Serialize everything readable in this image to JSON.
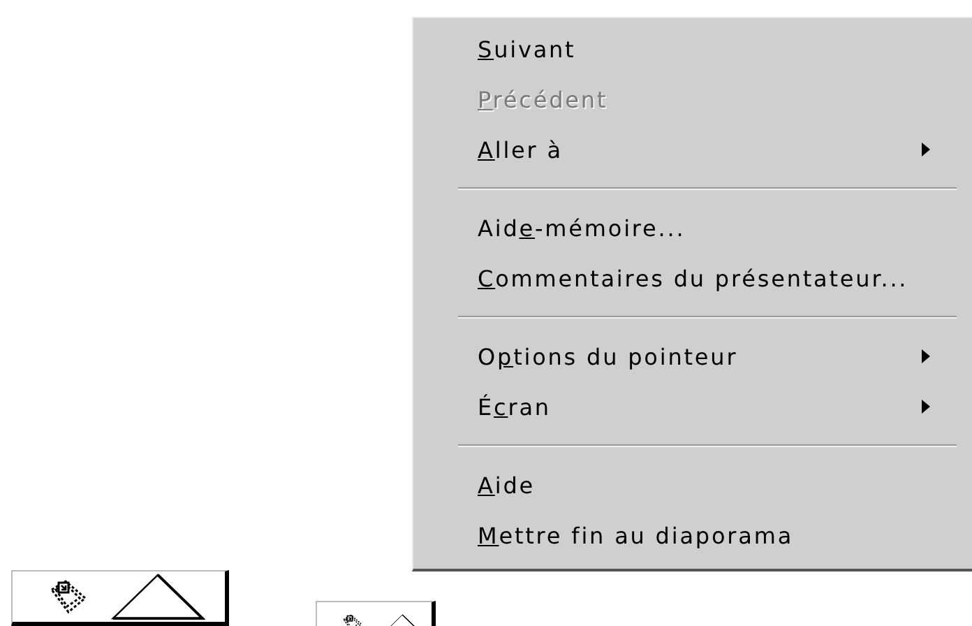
{
  "menu": {
    "items": [
      {
        "kind": "item",
        "access_key": "S",
        "label_after": "uivant",
        "disabled": false,
        "submenu": false
      },
      {
        "kind": "item",
        "access_key": "P",
        "label_after": "récédent",
        "disabled": true,
        "submenu": false
      },
      {
        "kind": "item",
        "access_key": "A",
        "label_after": "ller à",
        "disabled": false,
        "submenu": true
      },
      {
        "kind": "separator"
      },
      {
        "kind": "item",
        "label_before": "Aid",
        "access_key": "e",
        "label_after": "-mémoire...",
        "disabled": false,
        "submenu": false
      },
      {
        "kind": "item",
        "access_key": "C",
        "label_after": "ommentaires du présentateur...",
        "disabled": false,
        "submenu": false
      },
      {
        "kind": "separator"
      },
      {
        "kind": "item",
        "label_before": "O",
        "access_key": "p",
        "label_after": "tions du pointeur",
        "disabled": false,
        "submenu": true
      },
      {
        "kind": "item",
        "label_before": "É",
        "access_key": "c",
        "label_after": "ran",
        "disabled": false,
        "submenu": true
      },
      {
        "kind": "separator"
      },
      {
        "kind": "item",
        "access_key": "A",
        "label_after": "ide",
        "disabled": false,
        "submenu": false
      },
      {
        "kind": "item",
        "access_key": "M",
        "label_after": "ettre fin au diaporama",
        "disabled": false,
        "submenu": false
      }
    ]
  }
}
